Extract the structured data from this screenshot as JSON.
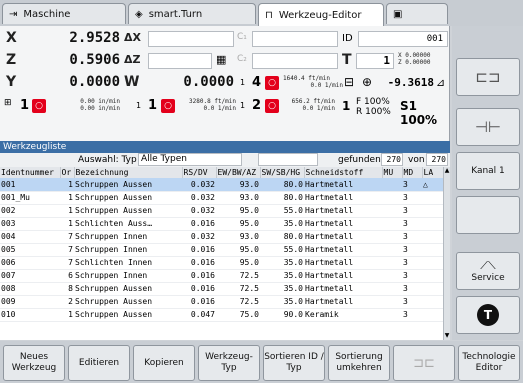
{
  "tabs": [
    {
      "label": "Maschine",
      "icon": "machine-icon"
    },
    {
      "label": "smart.Turn",
      "icon": "program-icon"
    },
    {
      "label": "Werkzeug-Editor",
      "icon": "tool-editor-icon"
    },
    {
      "label": "",
      "icon": "save-icon"
    }
  ],
  "display": {
    "x": {
      "axis": "X",
      "value": "2.9528",
      "delta": "ΔX"
    },
    "z": {
      "axis": "Z",
      "value": "0.5906",
      "delta": "ΔZ"
    },
    "y": {
      "axis": "Y",
      "value": "0.0000",
      "w": "W",
      "w_value": "0.0000"
    },
    "c1": "C₁",
    "c2": "C₂",
    "id_label": "ID",
    "id_value": "001",
    "t_label": "T",
    "t_value": "1",
    "x_offset": "X  0.00000",
    "z_offset": "Z  0.00000",
    "spindle_angle": "-9.3618",
    "feed1": "1640.4 ft/min",
    "feed1b": "0.0 1/min",
    "s4": "4",
    "feed_main": "0.00 in/min",
    "feed_main_b": "0.00 in/min",
    "s1": "1",
    "s1b": "1",
    "s1_speed": "3280.8 ft/min",
    "s1_speed_b": "0.0 1/min",
    "s2": "2",
    "s2_speed": "656.2 ft/min",
    "s2_speed_b": "0.0 1/min",
    "f_label": "F 100%",
    "r_label": "R 100%",
    "s_override": "S1 100%",
    "f_num": "1"
  },
  "list": {
    "title": "Werkzeugliste",
    "filter_label": "Auswahl: Typ",
    "filter_value": "Alle Typen",
    "found_label": "gefunden",
    "found_value": "270",
    "of_label": "von",
    "of_value": "270",
    "columns": [
      "Identnummer",
      "Or",
      "Bezeichnung",
      "RS/DV",
      "EW/BW/AZ",
      "SW/SB/HG",
      "Schneidstoff",
      "MU",
      "MD",
      "LA"
    ],
    "rows": [
      {
        "id": "001",
        "or": "1",
        "name": "Schruppen Aussen",
        "rs": "0.032",
        "ew": "93.0",
        "sw": "80.0",
        "mat": "Hartmetall",
        "md": "3",
        "la": "△",
        "selected": true
      },
      {
        "id": "001_Mu",
        "or": "1",
        "name": "Schruppen Aussen",
        "rs": "0.032",
        "ew": "93.0",
        "sw": "80.0",
        "mat": "Hartmetall",
        "md": "3",
        "la": "",
        "selected": false
      },
      {
        "id": "002",
        "or": "1",
        "name": "Schruppen Aussen",
        "rs": "0.032",
        "ew": "95.0",
        "sw": "55.0",
        "mat": "Hartmetall",
        "md": "3",
        "la": "",
        "selected": false
      },
      {
        "id": "003",
        "or": "1",
        "name": "Schlichten Auss…",
        "rs": "0.016",
        "ew": "95.0",
        "sw": "35.0",
        "mat": "Hartmetall",
        "md": "3",
        "la": "",
        "selected": false
      },
      {
        "id": "004",
        "or": "7",
        "name": "Schruppen Innen",
        "rs": "0.032",
        "ew": "93.0",
        "sw": "80.0",
        "mat": "Hartmetall",
        "md": "3",
        "la": "",
        "selected": false
      },
      {
        "id": "005",
        "or": "7",
        "name": "Schruppen Innen",
        "rs": "0.016",
        "ew": "95.0",
        "sw": "55.0",
        "mat": "Hartmetall",
        "md": "3",
        "la": "",
        "selected": false
      },
      {
        "id": "006",
        "or": "7",
        "name": "Schlichten Innen",
        "rs": "0.016",
        "ew": "95.0",
        "sw": "35.0",
        "mat": "Hartmetall",
        "md": "3",
        "la": "",
        "selected": false
      },
      {
        "id": "007",
        "or": "6",
        "name": "Schruppen Innen",
        "rs": "0.016",
        "ew": "72.5",
        "sw": "35.0",
        "mat": "Hartmetall",
        "md": "3",
        "la": "",
        "selected": false
      },
      {
        "id": "008",
        "or": "8",
        "name": "Schruppen Aussen",
        "rs": "0.016",
        "ew": "72.5",
        "sw": "35.0",
        "mat": "Hartmetall",
        "md": "3",
        "la": "",
        "selected": false
      },
      {
        "id": "009",
        "or": "2",
        "name": "Schruppen Aussen",
        "rs": "0.016",
        "ew": "72.5",
        "sw": "35.0",
        "mat": "Hartmetall",
        "md": "3",
        "la": "",
        "selected": false
      },
      {
        "id": "010",
        "or": "1",
        "name": "Schruppen Aussen",
        "rs": "0.047",
        "ew": "75.0",
        "sw": "90.0",
        "mat": "Keramik",
        "md": "3",
        "la": "",
        "selected": false
      }
    ]
  },
  "right_keys": [
    {
      "label": ""
    },
    {
      "label": ""
    },
    {
      "label": "Kanal 1"
    },
    {
      "label": ""
    },
    {
      "label": "Service"
    },
    {
      "label": ""
    }
  ],
  "bottom_keys": [
    {
      "label": "Neues Werkzeug"
    },
    {
      "label": "Editieren"
    },
    {
      "label": "Kopieren"
    },
    {
      "label": "Werkzeug-Typ"
    },
    {
      "label": "Sortieren ID / Typ"
    },
    {
      "label": "Sortierung umkehren"
    },
    {
      "label": ""
    },
    {
      "label": "Technologie Editor"
    }
  ],
  "colors": {
    "accent": "#3b6ea5",
    "selected_row": "#bcd6f3",
    "red": "#e3001b"
  }
}
